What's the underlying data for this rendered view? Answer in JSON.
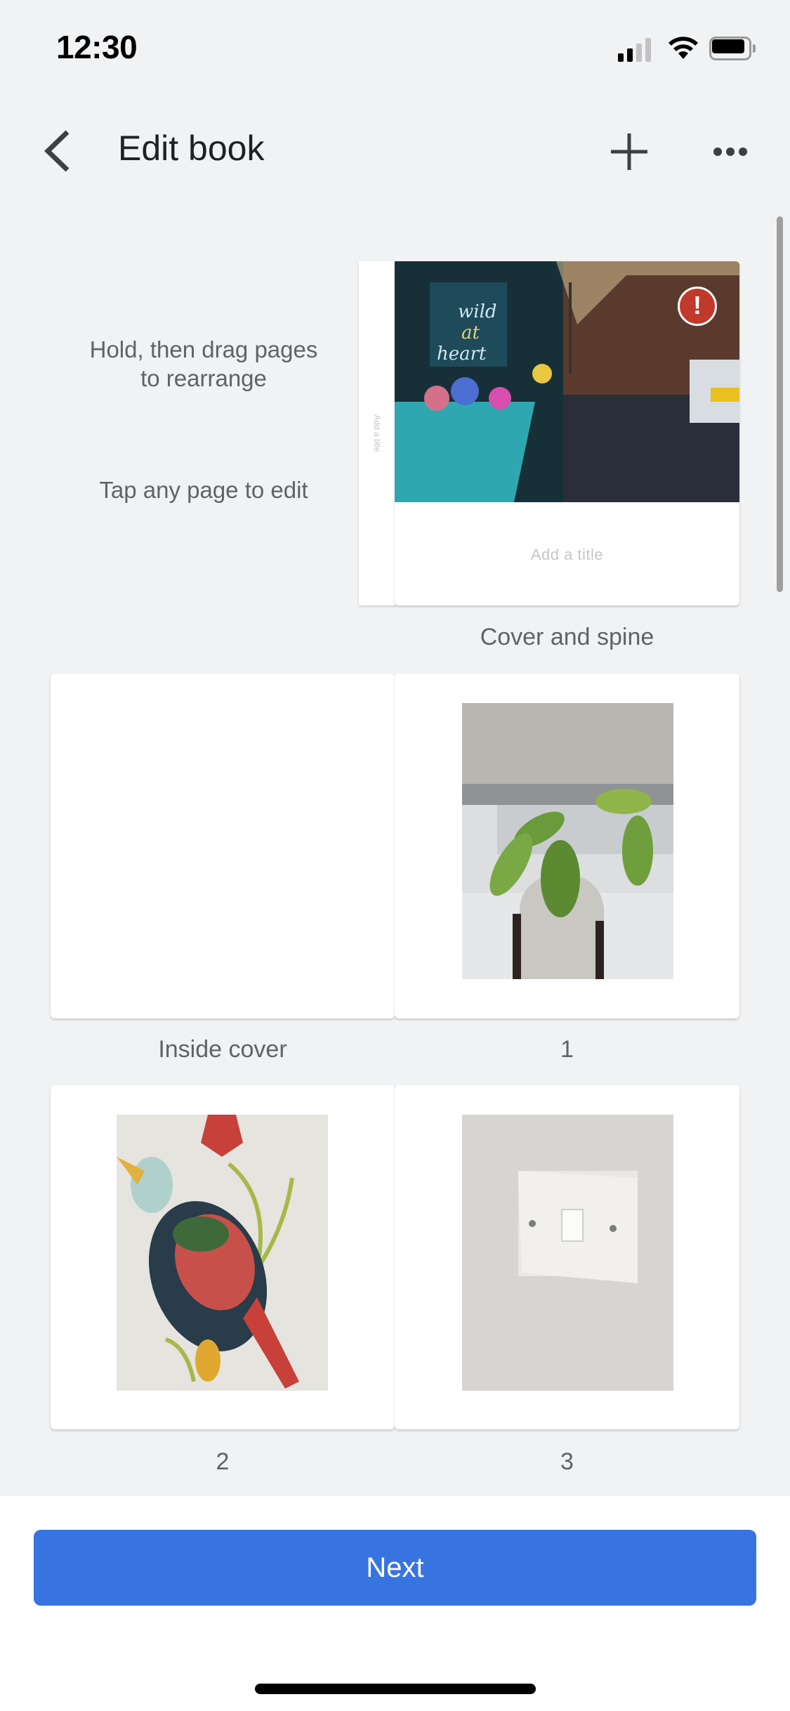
{
  "status_bar": {
    "time": "12:30",
    "signal_bars_active": 2,
    "signal_bars_total": 4,
    "battery_icon": "battery-full-icon",
    "wifi_icon": "wifi-icon"
  },
  "header": {
    "title": "Edit book",
    "back_icon": "chevron-left-icon",
    "add_icon": "plus-icon",
    "more_icon": "more-horizontal-icon"
  },
  "hints": {
    "rearrange": "Hold, then drag pages to rearrange",
    "edit": "Tap any page to edit"
  },
  "cover": {
    "spine_placeholder": "Add a title",
    "title_placeholder": "Add a title",
    "label": "Cover and spine",
    "photo_description": "Flower shop with neon sign 'wild at heart'",
    "warning_icon": "!",
    "warning_color": "#c0392b"
  },
  "pages": [
    {
      "label": "Inside cover",
      "has_photo": false
    },
    {
      "label": "1",
      "has_photo": true,
      "photo_description": "Potted plant on windowsill"
    },
    {
      "label": "2",
      "has_photo": true,
      "photo_description": "Folk art bird print"
    },
    {
      "label": "3",
      "has_photo": true,
      "photo_description": "Light switch on wall"
    }
  ],
  "footer": {
    "next_label": "Next",
    "accent_color": "#3874e0"
  }
}
